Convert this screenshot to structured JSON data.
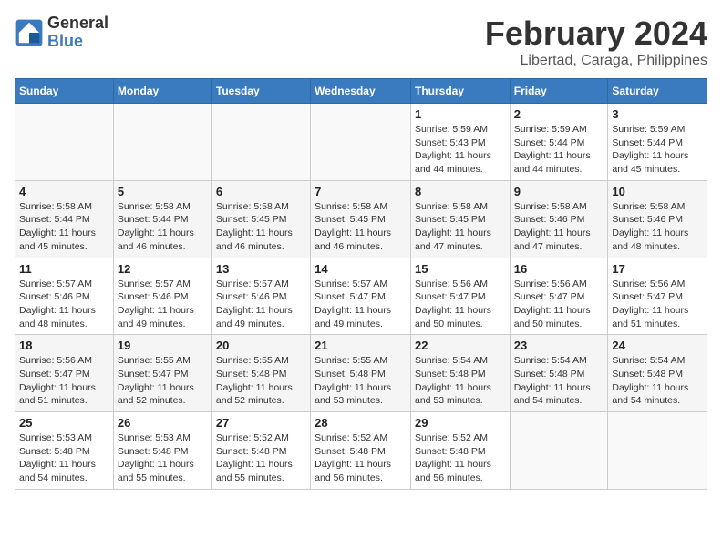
{
  "header": {
    "logo_line1": "General",
    "logo_line2": "Blue",
    "title": "February 2024",
    "subtitle": "Libertad, Caraga, Philippines"
  },
  "days_of_week": [
    "Sunday",
    "Monday",
    "Tuesday",
    "Wednesday",
    "Thursday",
    "Friday",
    "Saturday"
  ],
  "weeks": [
    [
      {
        "day": "",
        "sunrise": "",
        "sunset": "",
        "daylight": ""
      },
      {
        "day": "",
        "sunrise": "",
        "sunset": "",
        "daylight": ""
      },
      {
        "day": "",
        "sunrise": "",
        "sunset": "",
        "daylight": ""
      },
      {
        "day": "",
        "sunrise": "",
        "sunset": "",
        "daylight": ""
      },
      {
        "day": "1",
        "sunrise": "Sunrise: 5:59 AM",
        "sunset": "Sunset: 5:43 PM",
        "daylight": "Daylight: 11 hours and 44 minutes."
      },
      {
        "day": "2",
        "sunrise": "Sunrise: 5:59 AM",
        "sunset": "Sunset: 5:44 PM",
        "daylight": "Daylight: 11 hours and 44 minutes."
      },
      {
        "day": "3",
        "sunrise": "Sunrise: 5:59 AM",
        "sunset": "Sunset: 5:44 PM",
        "daylight": "Daylight: 11 hours and 45 minutes."
      }
    ],
    [
      {
        "day": "4",
        "sunrise": "Sunrise: 5:58 AM",
        "sunset": "Sunset: 5:44 PM",
        "daylight": "Daylight: 11 hours and 45 minutes."
      },
      {
        "day": "5",
        "sunrise": "Sunrise: 5:58 AM",
        "sunset": "Sunset: 5:44 PM",
        "daylight": "Daylight: 11 hours and 46 minutes."
      },
      {
        "day": "6",
        "sunrise": "Sunrise: 5:58 AM",
        "sunset": "Sunset: 5:45 PM",
        "daylight": "Daylight: 11 hours and 46 minutes."
      },
      {
        "day": "7",
        "sunrise": "Sunrise: 5:58 AM",
        "sunset": "Sunset: 5:45 PM",
        "daylight": "Daylight: 11 hours and 46 minutes."
      },
      {
        "day": "8",
        "sunrise": "Sunrise: 5:58 AM",
        "sunset": "Sunset: 5:45 PM",
        "daylight": "Daylight: 11 hours and 47 minutes."
      },
      {
        "day": "9",
        "sunrise": "Sunrise: 5:58 AM",
        "sunset": "Sunset: 5:46 PM",
        "daylight": "Daylight: 11 hours and 47 minutes."
      },
      {
        "day": "10",
        "sunrise": "Sunrise: 5:58 AM",
        "sunset": "Sunset: 5:46 PM",
        "daylight": "Daylight: 11 hours and 48 minutes."
      }
    ],
    [
      {
        "day": "11",
        "sunrise": "Sunrise: 5:57 AM",
        "sunset": "Sunset: 5:46 PM",
        "daylight": "Daylight: 11 hours and 48 minutes."
      },
      {
        "day": "12",
        "sunrise": "Sunrise: 5:57 AM",
        "sunset": "Sunset: 5:46 PM",
        "daylight": "Daylight: 11 hours and 49 minutes."
      },
      {
        "day": "13",
        "sunrise": "Sunrise: 5:57 AM",
        "sunset": "Sunset: 5:46 PM",
        "daylight": "Daylight: 11 hours and 49 minutes."
      },
      {
        "day": "14",
        "sunrise": "Sunrise: 5:57 AM",
        "sunset": "Sunset: 5:47 PM",
        "daylight": "Daylight: 11 hours and 49 minutes."
      },
      {
        "day": "15",
        "sunrise": "Sunrise: 5:56 AM",
        "sunset": "Sunset: 5:47 PM",
        "daylight": "Daylight: 11 hours and 50 minutes."
      },
      {
        "day": "16",
        "sunrise": "Sunrise: 5:56 AM",
        "sunset": "Sunset: 5:47 PM",
        "daylight": "Daylight: 11 hours and 50 minutes."
      },
      {
        "day": "17",
        "sunrise": "Sunrise: 5:56 AM",
        "sunset": "Sunset: 5:47 PM",
        "daylight": "Daylight: 11 hours and 51 minutes."
      }
    ],
    [
      {
        "day": "18",
        "sunrise": "Sunrise: 5:56 AM",
        "sunset": "Sunset: 5:47 PM",
        "daylight": "Daylight: 11 hours and 51 minutes."
      },
      {
        "day": "19",
        "sunrise": "Sunrise: 5:55 AM",
        "sunset": "Sunset: 5:47 PM",
        "daylight": "Daylight: 11 hours and 52 minutes."
      },
      {
        "day": "20",
        "sunrise": "Sunrise: 5:55 AM",
        "sunset": "Sunset: 5:48 PM",
        "daylight": "Daylight: 11 hours and 52 minutes."
      },
      {
        "day": "21",
        "sunrise": "Sunrise: 5:55 AM",
        "sunset": "Sunset: 5:48 PM",
        "daylight": "Daylight: 11 hours and 53 minutes."
      },
      {
        "day": "22",
        "sunrise": "Sunrise: 5:54 AM",
        "sunset": "Sunset: 5:48 PM",
        "daylight": "Daylight: 11 hours and 53 minutes."
      },
      {
        "day": "23",
        "sunrise": "Sunrise: 5:54 AM",
        "sunset": "Sunset: 5:48 PM",
        "daylight": "Daylight: 11 hours and 54 minutes."
      },
      {
        "day": "24",
        "sunrise": "Sunrise: 5:54 AM",
        "sunset": "Sunset: 5:48 PM",
        "daylight": "Daylight: 11 hours and 54 minutes."
      }
    ],
    [
      {
        "day": "25",
        "sunrise": "Sunrise: 5:53 AM",
        "sunset": "Sunset: 5:48 PM",
        "daylight": "Daylight: 11 hours and 54 minutes."
      },
      {
        "day": "26",
        "sunrise": "Sunrise: 5:53 AM",
        "sunset": "Sunset: 5:48 PM",
        "daylight": "Daylight: 11 hours and 55 minutes."
      },
      {
        "day": "27",
        "sunrise": "Sunrise: 5:52 AM",
        "sunset": "Sunset: 5:48 PM",
        "daylight": "Daylight: 11 hours and 55 minutes."
      },
      {
        "day": "28",
        "sunrise": "Sunrise: 5:52 AM",
        "sunset": "Sunset: 5:48 PM",
        "daylight": "Daylight: 11 hours and 56 minutes."
      },
      {
        "day": "29",
        "sunrise": "Sunrise: 5:52 AM",
        "sunset": "Sunset: 5:48 PM",
        "daylight": "Daylight: 11 hours and 56 minutes."
      },
      {
        "day": "",
        "sunrise": "",
        "sunset": "",
        "daylight": ""
      },
      {
        "day": "",
        "sunrise": "",
        "sunset": "",
        "daylight": ""
      }
    ]
  ]
}
